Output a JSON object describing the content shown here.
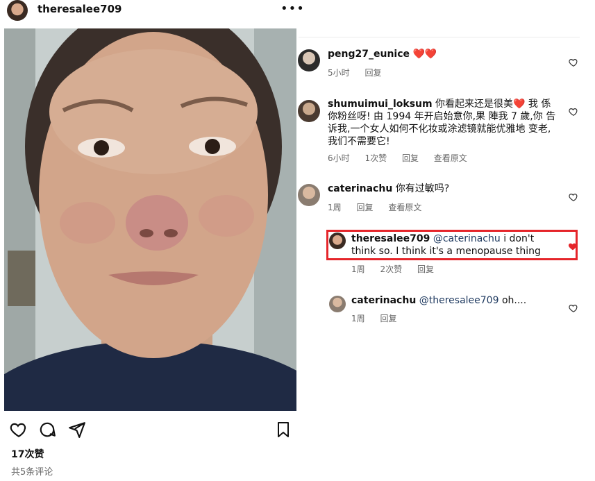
{
  "header": {
    "username": "theresalee709",
    "more_icon": "more-horizontal-icon"
  },
  "post": {
    "likes": "17次赞",
    "comment_count": "共5条评论"
  },
  "comments": [
    {
      "user": "peng27_eunice",
      "text": "❤️❤️",
      "time": "5小时",
      "likes": "",
      "reply": "回复",
      "translate": ""
    },
    {
      "user": "shumuimui_loksum",
      "text": "你看起来还是很美❤️ 我 係 你粉丝呀! 由 1994 年开启始意你,果 陣我 7 歲,你 告诉我,一个女人如何不化妆或涂滤镜就能优雅地 变老,我们不需要它!",
      "time": "6小时",
      "likes": "1次赞",
      "reply": "回复",
      "translate": "查看原文"
    },
    {
      "user": "caterinachu",
      "text": "你有过敏吗?",
      "time": "1周",
      "likes": "",
      "reply": "回复",
      "translate": "查看原文"
    },
    {
      "user": "theresalee709",
      "mention": "@caterinachu",
      "text": "i don't think so. I think it's a menopause thing",
      "time": "1周",
      "likes": "2次赞",
      "reply": "回复",
      "translate": ""
    },
    {
      "user": "caterinachu",
      "mention": "@theresalee709",
      "text": "oh....",
      "time": "1周",
      "likes": "",
      "reply": "回复",
      "translate": ""
    }
  ],
  "colors": {
    "highlight": "#e5252a",
    "liked_heart": "#ed4956",
    "mention": "#1f3a60"
  }
}
